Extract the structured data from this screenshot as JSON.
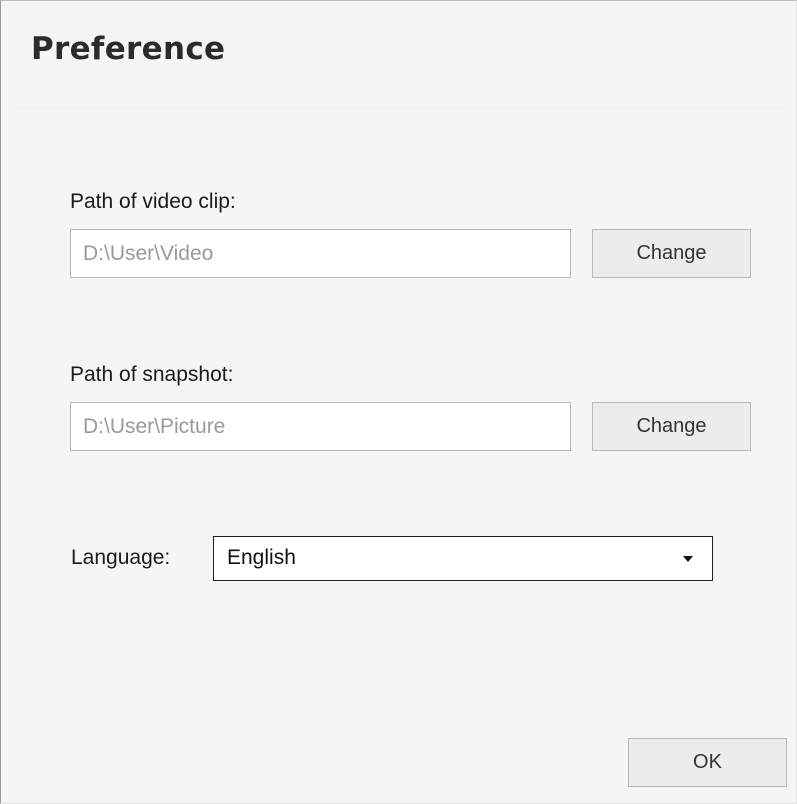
{
  "dialog": {
    "title": "Preference"
  },
  "video": {
    "label": "Path of video clip:",
    "path": "D:\\User\\Video",
    "change_label": "Change"
  },
  "snapshot": {
    "label": "Path of snapshot:",
    "path": "D:\\User\\Picture",
    "change_label": "Change"
  },
  "language": {
    "label": "Language:",
    "selected": "English",
    "icon": "chevron-down-icon"
  },
  "footer": {
    "ok_label": "OK"
  }
}
